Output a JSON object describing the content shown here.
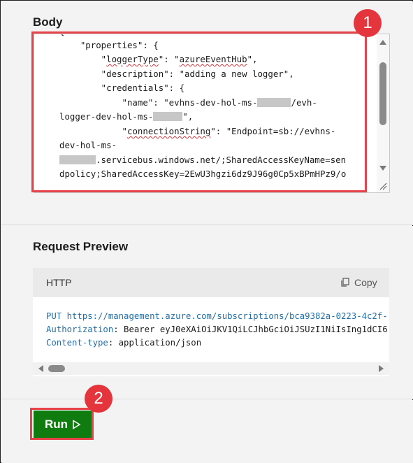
{
  "body_section": {
    "title": "Body",
    "lines": [
      "{",
      "    \"properties\": {",
      "        \"loggerType\": \"azureEventHub\",",
      "        \"description\": \"adding a new logger\",",
      "        \"credentials\": {",
      "            \"name\": \"evhns-dev-hol-ms-",
      "/evh-",
      "logger-dev-hol-ms-",
      "\",",
      "            \"connectionString\": \"Endpoint=sb://evhns-",
      "dev-hol-ms-",
      ".servicebus.windows.net/;SharedAccessKeyName=sen",
      "dpolicy;SharedAccessKey=2EwU3hgzi6dz9J96g0Cp5xBPmHPz9/o"
    ]
  },
  "preview_section": {
    "title": "Request Preview",
    "language": "HTTP",
    "copy_label": "Copy",
    "method": "PUT",
    "url": "https://management.azure.com/subscriptions/bca9382a-0223-4c2f-",
    "auth_key": "Authorization",
    "auth_value": ": Bearer eyJ0eXAiOiJKV1QiLCJhbGciOiJSUzI1NiIsIng1dCI6",
    "ct_key": "Content-type",
    "ct_value": ": application/json"
  },
  "run": {
    "label": "Run"
  },
  "callouts": {
    "one": "1",
    "two": "2"
  },
  "colors": {
    "accent": "#e5353c",
    "run_green": "#107c10",
    "code_keyword": "#1f6fa8"
  },
  "icons": [
    "copy-icon",
    "play-icon",
    "scroll-up-icon",
    "scroll-down-icon",
    "resize-grip-icon"
  ]
}
